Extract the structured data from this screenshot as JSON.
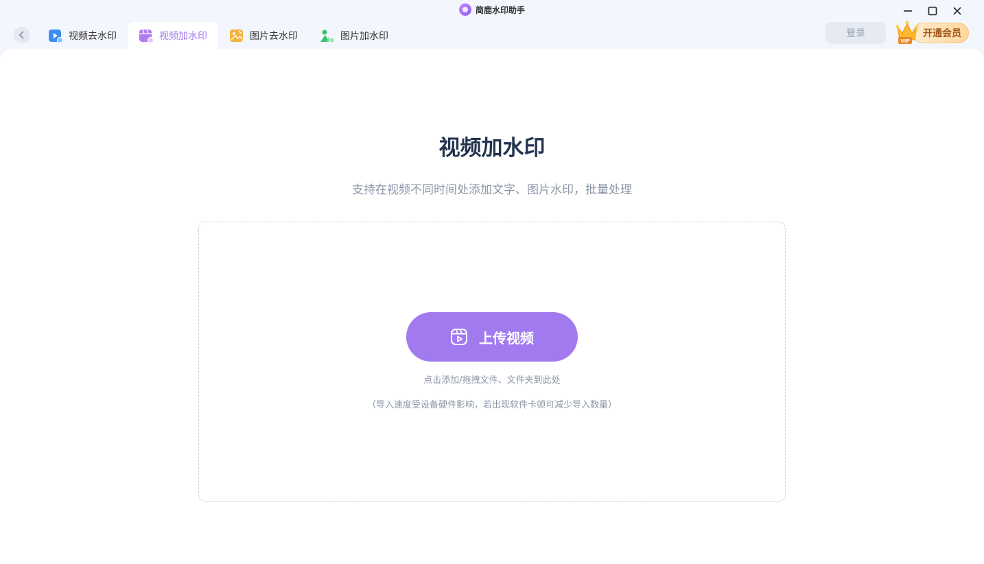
{
  "window": {
    "title": "简鹿水印助手",
    "controls": [
      "minimize-icon",
      "maximize-icon",
      "close-icon"
    ]
  },
  "tabs": [
    {
      "label": "视频去水印",
      "icon": "video-remove-watermark-icon",
      "active": false,
      "color": "#3d8cf5"
    },
    {
      "label": "视频加水印",
      "icon": "video-add-watermark-icon",
      "active": true,
      "color": "#b07cf0"
    },
    {
      "label": "图片去水印",
      "icon": "image-remove-watermark-icon",
      "active": false,
      "color": "#f5a623"
    },
    {
      "label": "图片加水印",
      "icon": "image-add-watermark-icon",
      "active": false,
      "color": "#3bbf6a"
    }
  ],
  "header": {
    "login_label": "登录",
    "vip_label": "开通会员",
    "vip_badge": "VIP"
  },
  "main": {
    "title": "视频加水印",
    "subtitle": "支持在视频不同时间处添加文字、图片水印，批量处理",
    "upload_label": "上传视频",
    "hint": "点击添加/拖拽文件、文件夹到此处",
    "note": "（导入速度受设备硬件影响，若出现软件卡顿可减少导入数量）"
  },
  "colors": {
    "accent": "#a27af0",
    "heading": "#23344f",
    "muted": "#8d96a7"
  }
}
